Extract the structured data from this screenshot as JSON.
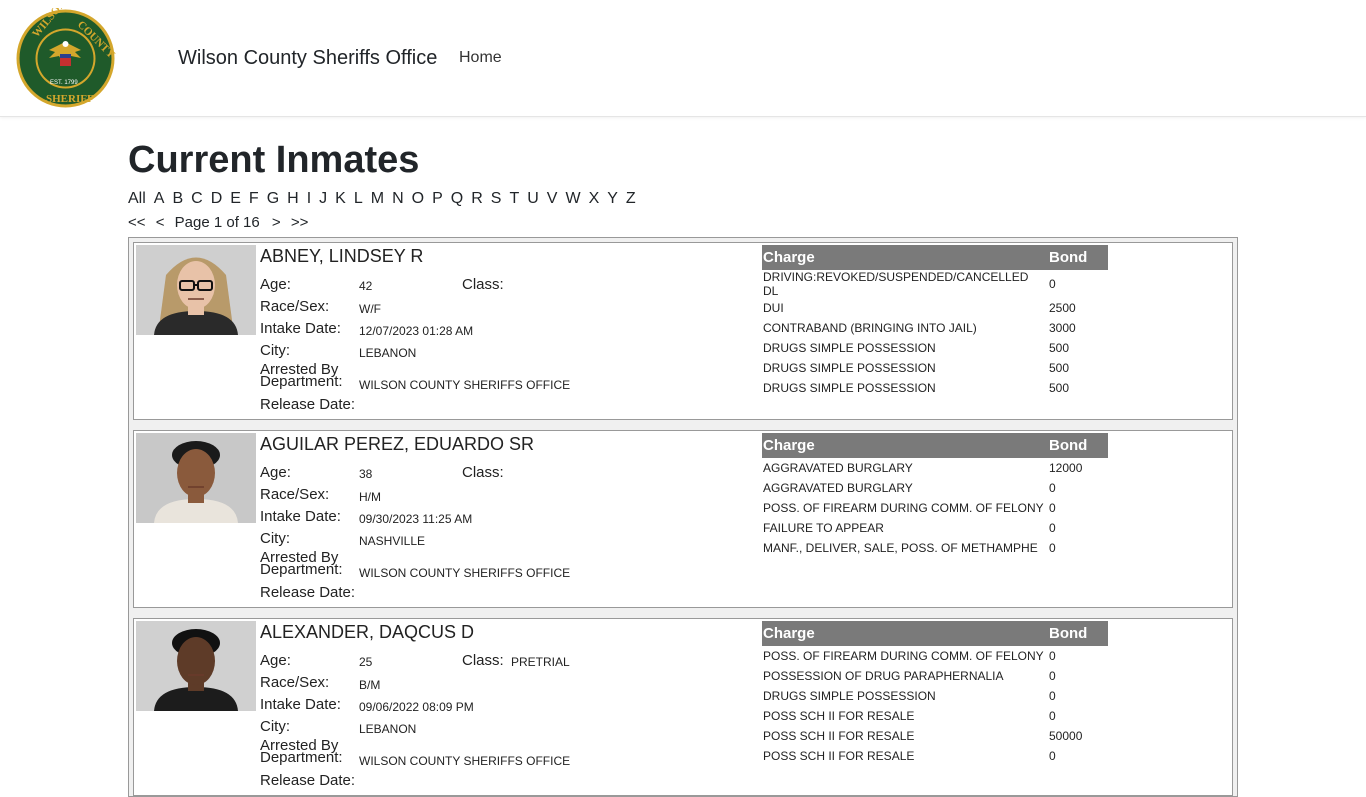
{
  "header": {
    "logo": {
      "top_text": "WILSON",
      "right_text": "COUNTY",
      "est": "EST. 1799",
      "bottom_text": "SHERIFF"
    },
    "brand": "Wilson County Sheriffs Office",
    "nav_home": "Home"
  },
  "page_title": "Current Inmates",
  "alphabet": [
    "All",
    "A",
    "B",
    "C",
    "D",
    "E",
    "F",
    "G",
    "H",
    "I",
    "J",
    "K",
    "L",
    "M",
    "N",
    "O",
    "P",
    "Q",
    "R",
    "S",
    "T",
    "U",
    "V",
    "W",
    "X",
    "Y",
    "Z"
  ],
  "pager": {
    "first": "<<",
    "prev": "<",
    "label": "Page 1 of 16",
    "next": ">",
    "last": ">>"
  },
  "labels": {
    "age": "Age:",
    "class": "Class:",
    "race_sex": "Race/Sex:",
    "intake": "Intake Date:",
    "city": "City:",
    "arrested_by": "Arrested By",
    "department": "Department:",
    "release": "Release Date:",
    "charge": "Charge",
    "bond": "Bond"
  },
  "inmates": [
    {
      "name": "ABNEY, LINDSEY R",
      "age": "42",
      "class": "",
      "race_sex": "W/F",
      "intake": "12/07/2023 01:28 AM",
      "city": "LEBANON",
      "department": "WILSON COUNTY SHERIFFS OFFICE",
      "release": "",
      "charges": [
        {
          "charge": "DRIVING:REVOKED/SUSPENDED/CANCELLED DL",
          "bond": "0"
        },
        {
          "charge": "DUI",
          "bond": "2500"
        },
        {
          "charge": "CONTRABAND (BRINGING INTO JAIL)",
          "bond": "3000"
        },
        {
          "charge": "DRUGS SIMPLE POSSESSION",
          "bond": "500"
        },
        {
          "charge": "DRUGS SIMPLE POSSESSION",
          "bond": "500"
        },
        {
          "charge": "DRUGS SIMPLE POSSESSION",
          "bond": "500"
        }
      ]
    },
    {
      "name": "AGUILAR PEREZ, EDUARDO SR",
      "age": "38",
      "class": "",
      "race_sex": "H/M",
      "intake": "09/30/2023 11:25 AM",
      "city": "NASHVILLE",
      "department": "WILSON COUNTY SHERIFFS OFFICE",
      "release": "",
      "charges": [
        {
          "charge": "AGGRAVATED BURGLARY",
          "bond": "12000"
        },
        {
          "charge": "AGGRAVATED BURGLARY",
          "bond": "0"
        },
        {
          "charge": "POSS. OF FIREARM DURING COMM. OF FELONY",
          "bond": "0"
        },
        {
          "charge": "FAILURE TO APPEAR",
          "bond": "0"
        },
        {
          "charge": "MANF., DELIVER, SALE, POSS. OF METHAMPHE",
          "bond": "0"
        }
      ]
    },
    {
      "name": "ALEXANDER, DAQCUS D",
      "age": "25",
      "class": "PRETRIAL",
      "race_sex": "B/M",
      "intake": "09/06/2022 08:09 PM",
      "city": "LEBANON",
      "department": "WILSON COUNTY SHERIFFS OFFICE",
      "release": "",
      "charges": [
        {
          "charge": "POSS. OF FIREARM DURING COMM. OF FELONY",
          "bond": "0"
        },
        {
          "charge": "POSSESSION OF DRUG PARAPHERNALIA",
          "bond": "0"
        },
        {
          "charge": "DRUGS SIMPLE POSSESSION",
          "bond": "0"
        },
        {
          "charge": "POSS SCH II FOR RESALE",
          "bond": "0"
        },
        {
          "charge": "POSS SCH II FOR RESALE",
          "bond": "50000"
        },
        {
          "charge": "POSS SCH II FOR RESALE",
          "bond": "0"
        }
      ]
    }
  ],
  "colors": {
    "logo_green": "#1f5a2a",
    "logo_gold": "#d4a72c",
    "table_header": "#7a7a7a"
  }
}
